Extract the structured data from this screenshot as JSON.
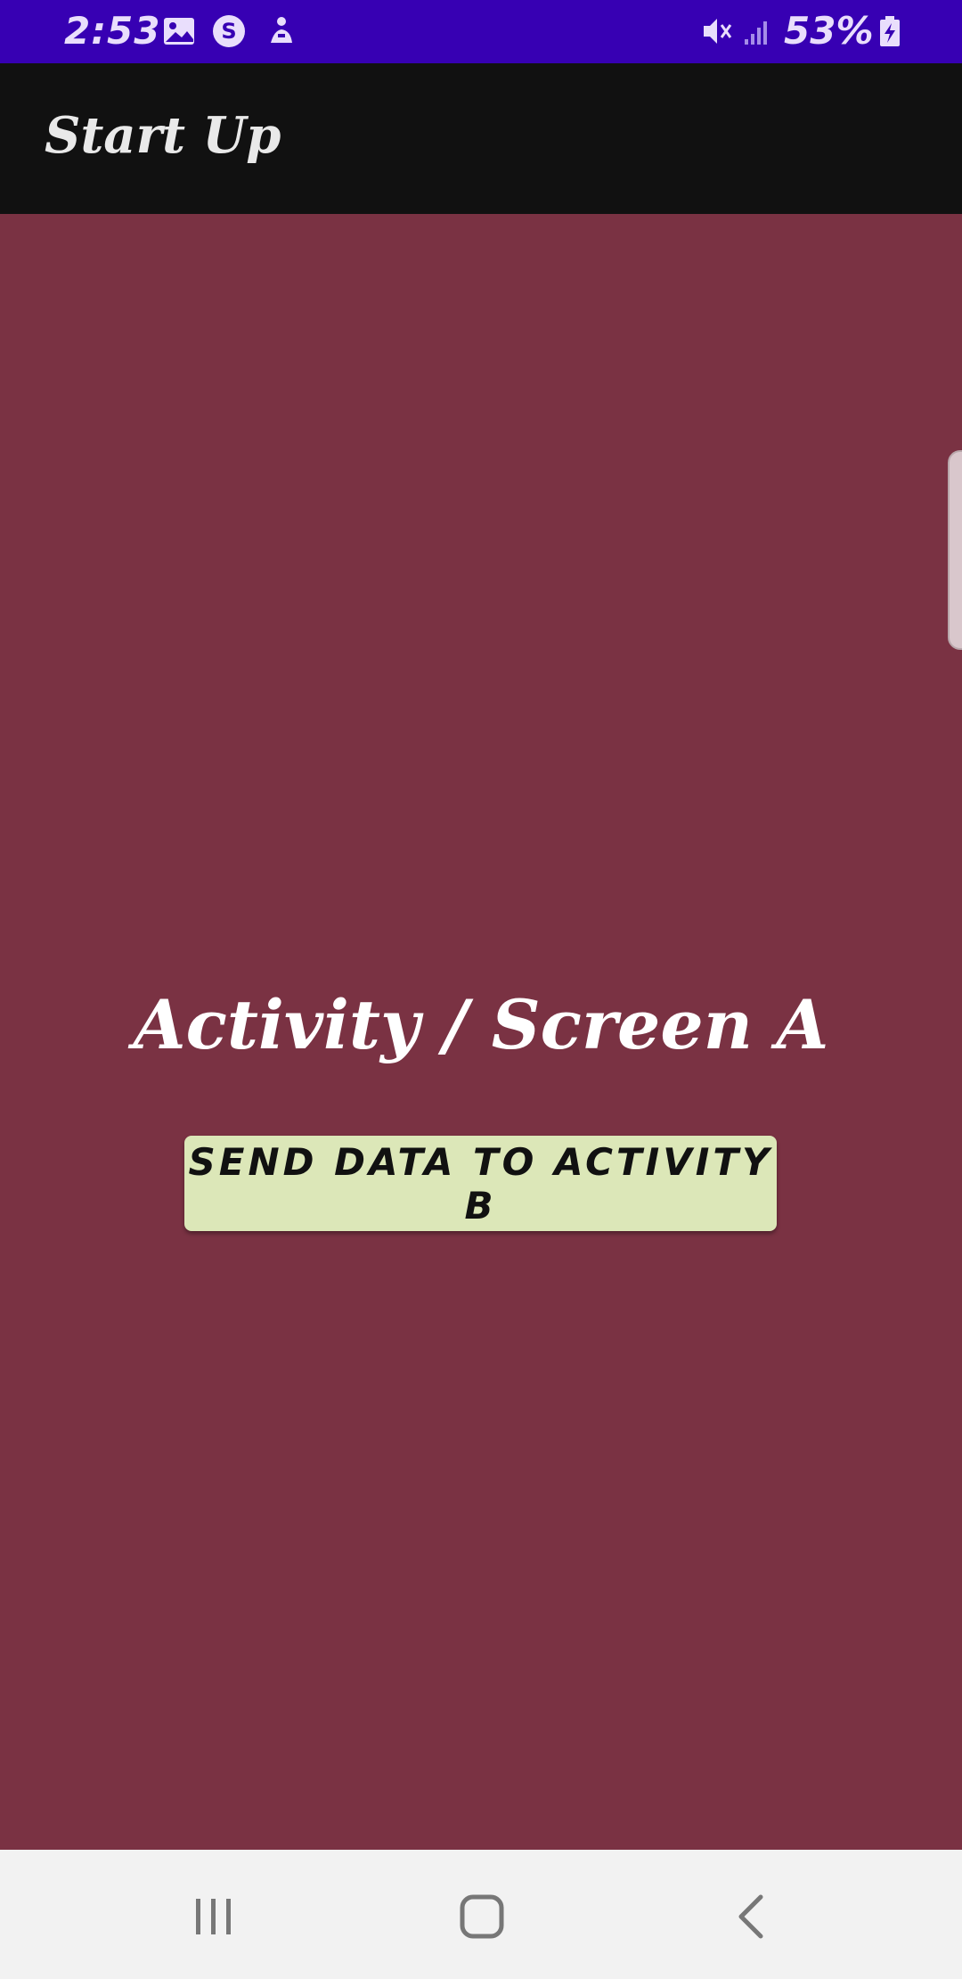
{
  "status_bar": {
    "time": "2:53",
    "battery_percent": "53%",
    "background_color": "#3700b3",
    "icons": [
      "gallery-icon",
      "skype-icon",
      "app-notification-icon",
      "mute-icon",
      "signal-icon",
      "battery-charging-icon"
    ]
  },
  "app_bar": {
    "title": "Start Up",
    "background_color": "#111111"
  },
  "main": {
    "background_color": "#7a3243",
    "heading": "Activity / Screen A",
    "send_button_label": "SEND DATA TO ACTIVITY B",
    "send_button_color": "#dce7b8"
  },
  "nav_bar": {
    "buttons": [
      "recent-apps-icon",
      "home-icon",
      "back-icon"
    ]
  }
}
